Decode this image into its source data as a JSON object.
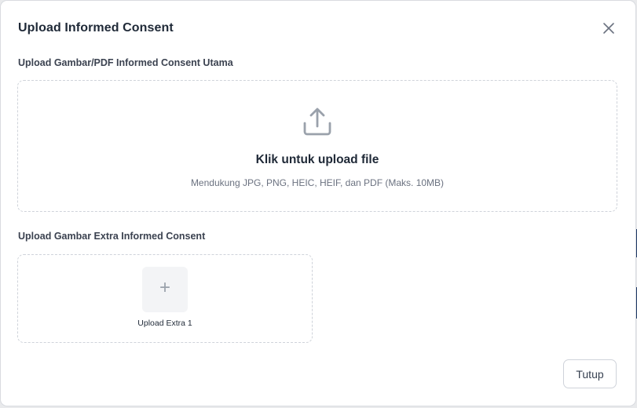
{
  "modal": {
    "title": "Upload Informed Consent",
    "close_icon": "close-icon"
  },
  "main_upload": {
    "label": "Upload Gambar/PDF Informed Consent Utama",
    "icon": "upload-icon",
    "title": "Klik untuk upload file",
    "subtitle": "Mendukung JPG, PNG, HEIC, HEIF, dan PDF (Maks. 10MB)"
  },
  "extra_upload": {
    "label": "Upload Gambar Extra Informed Consent",
    "items": [
      {
        "icon": "plus-icon",
        "symbol": "+",
        "caption": "Upload Extra 1"
      }
    ]
  },
  "footer": {
    "close_label": "Tutup"
  },
  "colors": {
    "text_primary": "#1f2937",
    "text_secondary": "#6b7280",
    "border_dashed": "#cfd3da",
    "icon_gray": "#9aa1ab",
    "tile_bg": "#f3f4f6"
  }
}
